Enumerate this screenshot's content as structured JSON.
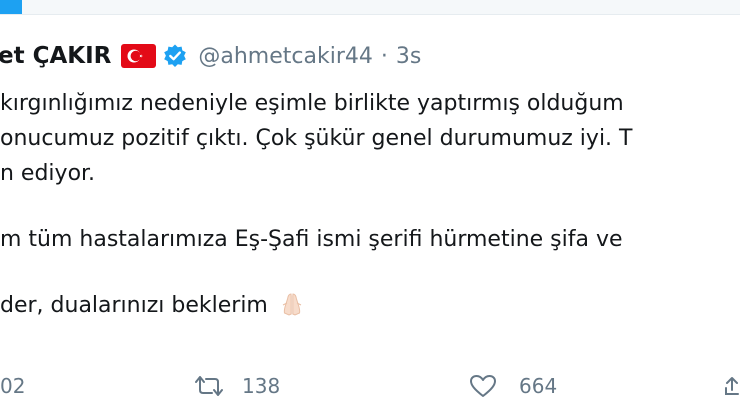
{
  "tweet": {
    "author_name": "et ÇAKIR",
    "handle": "@ahmetcakir44",
    "separator": "·",
    "time": "3s",
    "lines": [
      "kırgınlığımız nedeniyle eşimle birlikte yaptırmış olduğum",
      "onucumuz pozitif çıktı. Çok şükür genel durumumuz iyi. T",
      "n ediyor.",
      "m tüm hastalarımıza Eş-Şafi ismi şerifi hürmetine şifa ve",
      "der, dualarınızı beklerim"
    ],
    "emoji": "folded-hands-emoji",
    "flag": "turkey-flag-icon"
  },
  "actions": {
    "reply_count": "02",
    "retweet_count": "138",
    "like_count": "664"
  },
  "colors": {
    "accent": "#1da1f2",
    "text": "#14171a",
    "muted": "#657786",
    "flag_red": "#e30a17"
  }
}
